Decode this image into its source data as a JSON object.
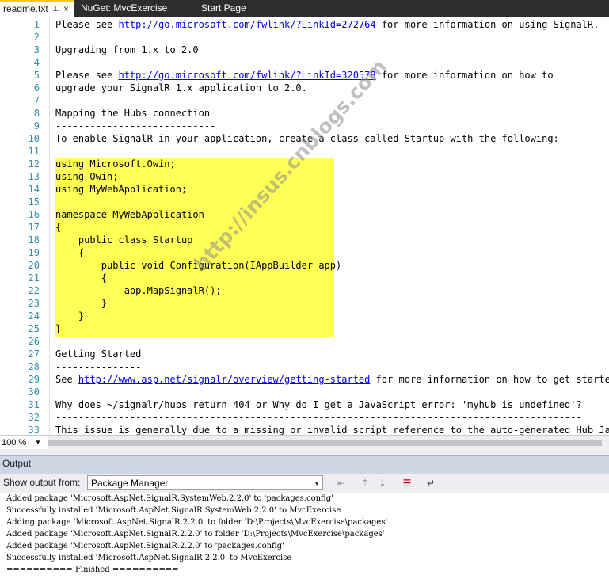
{
  "tabs": [
    {
      "label": "readme.txt",
      "active": true
    },
    {
      "label": "NuGet: MvcExercise",
      "active": false
    },
    {
      "label": "Start Page",
      "active": false
    }
  ],
  "tab_icons": {
    "pin": "pin-icon",
    "close": "close-icon"
  },
  "editor": {
    "lines": [
      {
        "n": "1",
        "text": "Please see ",
        "link": "http://go.microsoft.com/fwlink/?LinkId=272764",
        "after": " for more information on using SignalR."
      },
      {
        "n": "2",
        "text": ""
      },
      {
        "n": "3",
        "text": "Upgrading from 1.x to 2.0"
      },
      {
        "n": "4",
        "text": "-------------------------"
      },
      {
        "n": "5",
        "text": "Please see ",
        "link": "http://go.microsoft.com/fwlink/?LinkId=320578",
        "after": " for more information on how to"
      },
      {
        "n": "6",
        "text": "upgrade your SignalR 1.x application to 2.0."
      },
      {
        "n": "7",
        "text": ""
      },
      {
        "n": "8",
        "text": "Mapping the Hubs connection"
      },
      {
        "n": "9",
        "text": "----------------------------"
      },
      {
        "n": "10",
        "text": "To enable SignalR in your application, create a class called Startup with the following:"
      },
      {
        "n": "11",
        "text": ""
      },
      {
        "n": "12",
        "text": "using Microsoft.Owin;"
      },
      {
        "n": "13",
        "text": "using Owin;"
      },
      {
        "n": "14",
        "text": "using MyWebApplication;"
      },
      {
        "n": "15",
        "text": ""
      },
      {
        "n": "16",
        "text": "namespace MyWebApplication"
      },
      {
        "n": "17",
        "text": "{"
      },
      {
        "n": "18",
        "text": "    public class Startup"
      },
      {
        "n": "19",
        "text": "    {"
      },
      {
        "n": "20",
        "text": "        public void Configuration(IAppBuilder app)"
      },
      {
        "n": "21",
        "text": "        {"
      },
      {
        "n": "22",
        "text": "            app.MapSignalR();"
      },
      {
        "n": "23",
        "text": "        }"
      },
      {
        "n": "24",
        "text": "    }"
      },
      {
        "n": "25",
        "text": "}"
      },
      {
        "n": "26",
        "text": ""
      },
      {
        "n": "27",
        "text": "Getting Started"
      },
      {
        "n": "28",
        "text": "---------------"
      },
      {
        "n": "29",
        "text": "See ",
        "link": "http://www.asp.net/signalr/overview/getting-started",
        "after": " for more information on how to get started."
      },
      {
        "n": "30",
        "text": ""
      },
      {
        "n": "31",
        "text": "Why does ~/signalr/hubs return 404 or Why do I get a JavaScript error: 'myhub is undefined'?"
      },
      {
        "n": "32",
        "text": "--------------------------------------------------------------------------------------------"
      },
      {
        "n": "33",
        "text": "This issue is generally due to a missing or invalid script reference to the auto-generated Hub JavaS"
      }
    ],
    "highlight_color": "#ffff55",
    "watermark": "http://insus.cnblogs.com"
  },
  "zoom": {
    "value": "100 %"
  },
  "output": {
    "title": "Output",
    "show_label": "Show output from:",
    "source": "Package Manager",
    "toolbar_icons": [
      "find-message-icon",
      "previous-message-icon",
      "next-message-icon",
      "clear-all-icon",
      "word-wrap-icon"
    ],
    "lines": [
      "Added package 'Microsoft.AspNet.SignalR.SystemWeb.2.2.0' to 'packages.config'",
      "Successfully installed 'Microsoft.AspNet.SignalR.SystemWeb 2.2.0' to MvcExercise",
      "Adding package 'Microsoft.AspNet.SignalR.2.2.0' to folder 'D:\\Projects\\MvcExercise\\packages'",
      "Added package 'Microsoft.AspNet.SignalR.2.2.0' to folder 'D:\\Projects\\MvcExercise\\packages'",
      "Added package 'Microsoft.AspNet.SignalR.2.2.0' to 'packages.config'",
      "Successfully installed 'Microsoft.AspNet.SignalR 2.2.0' to MvcExercise",
      "========== Finished =========="
    ]
  },
  "colors": {
    "accent": "#ffcc00",
    "line_numbers": "#2b91af",
    "link": "#0000ee",
    "tabbar": "#2d2d30"
  }
}
